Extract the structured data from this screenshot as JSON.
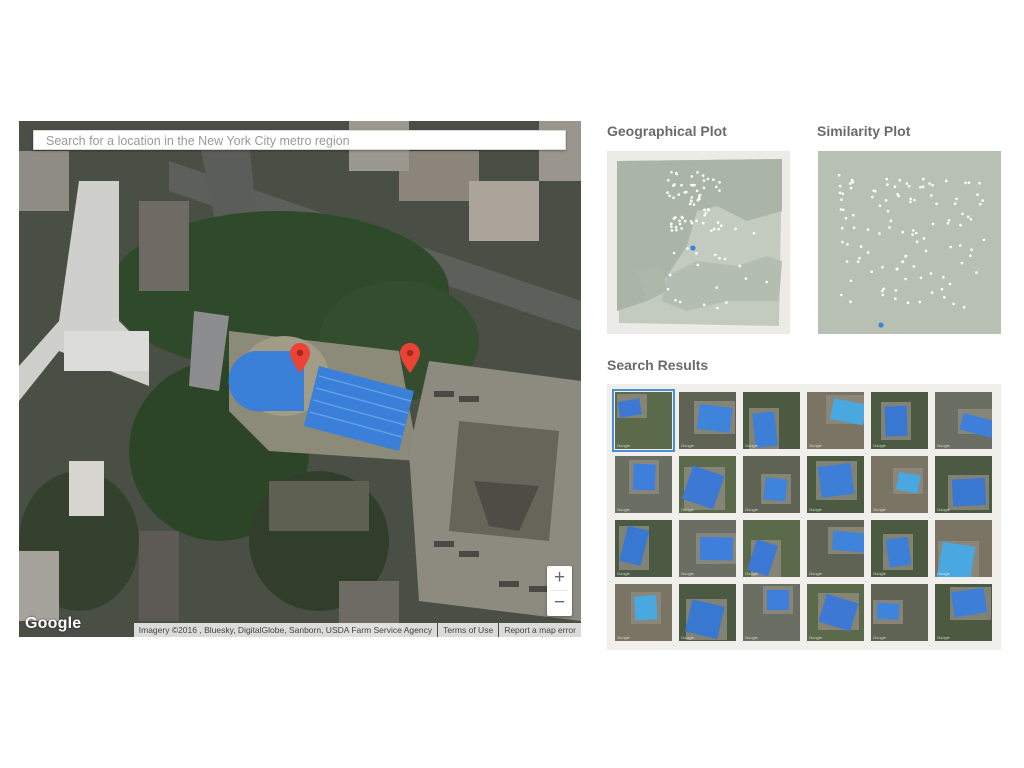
{
  "map": {
    "search_placeholder": "Search for a location in the New York City metro region",
    "google_logo": "Google",
    "zoom_in": "+",
    "zoom_out": "−",
    "attribution": "Imagery ©2016 , Bluesky, DigitalGlobe, Sanborn, USDA Farm Service Agency",
    "terms": "Terms of Use",
    "report": "Report a map error",
    "pin_color": "#ea4335",
    "pool_color": "#3a7fd8"
  },
  "geo_plot": {
    "title": "Geographical Plot"
  },
  "similarity_plot": {
    "title": "Similarity Plot"
  },
  "search_results": {
    "title": "Search Results",
    "selected_index": 0,
    "thumb_watermark": "Google",
    "thumbnails": [
      "pool-tile",
      "pool-tile",
      "pool-tile",
      "pool-tile",
      "pool-tile",
      "pool-tile",
      "pool-tile",
      "pool-tile",
      "pool-tile",
      "pool-tile",
      "pool-tile",
      "pool-tile",
      "pool-tile",
      "pool-tile",
      "pool-tile",
      "pool-tile",
      "pool-tile",
      "pool-tile",
      "pool-tile",
      "pool-tile",
      "pool-tile",
      "pool-tile",
      "pool-tile",
      "pool-tile"
    ]
  },
  "colors": {
    "accent": "#4a8fd6",
    "plot_dot": "#ffffff",
    "highlight_dot": "#3b86d1"
  }
}
